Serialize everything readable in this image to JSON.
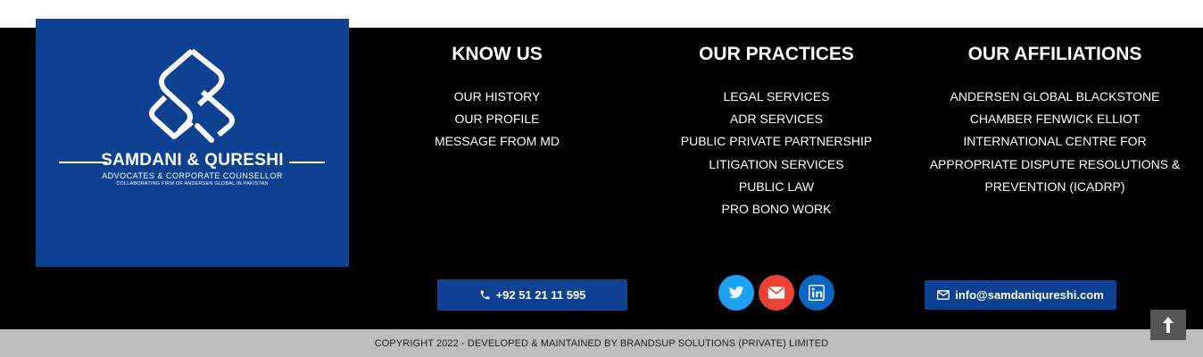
{
  "logo": {
    "name": "SAMDANI & QURESHI",
    "tagline": "ADVOCATES & CORPORATE COUNSELLOR",
    "subline": "COLLABORATING FIRM OF ANDERSEN GLOBAL IN PAKISTAN"
  },
  "columns": {
    "know_us": {
      "title": "KNOW US",
      "items": [
        "OUR HISTORY",
        "OUR PROFILE",
        "MESSAGE FROM MD"
      ]
    },
    "practices": {
      "title": "OUR PRACTICES",
      "items": [
        "LEGAL SERVICES",
        "ADR SERVICES",
        "PUBLIC PRIVATE PARTNERSHIP",
        "LITIGATION SERVICES",
        "PUBLIC LAW",
        "PRO BONO WORK"
      ]
    },
    "affiliations": {
      "title": "OUR AFFILIATIONS",
      "items": [
        "ANDERSEN GLOBAL BLACKSTONE",
        "CHAMBER FENWICK ELLIOT",
        "INTERNATIONAL CENTRE FOR",
        "APPROPRIATE DISPUTE RESOLUTIONS &",
        "PREVENTION (ICADRP)"
      ]
    }
  },
  "contact": {
    "phone": "+92 51 21 11 595",
    "email": "info@samdaniqureshi.com"
  },
  "social": [
    {
      "icon": "twitter-icon",
      "color": "#1da1f2"
    },
    {
      "icon": "email-icon",
      "color": "#ea4335"
    },
    {
      "icon": "linkedin-icon",
      "color": "#0a66c2"
    }
  ],
  "colors": {
    "brand_blue": "#0f4192",
    "footer_bg": "#000000",
    "copyright_bg": "#bdbdbd"
  },
  "copyright": "COPYRIGHT 2022 - DEVELOPED & MAINTAINED BY BRANDSUP SOLUTIONS (PRIVATE) LIMITED"
}
